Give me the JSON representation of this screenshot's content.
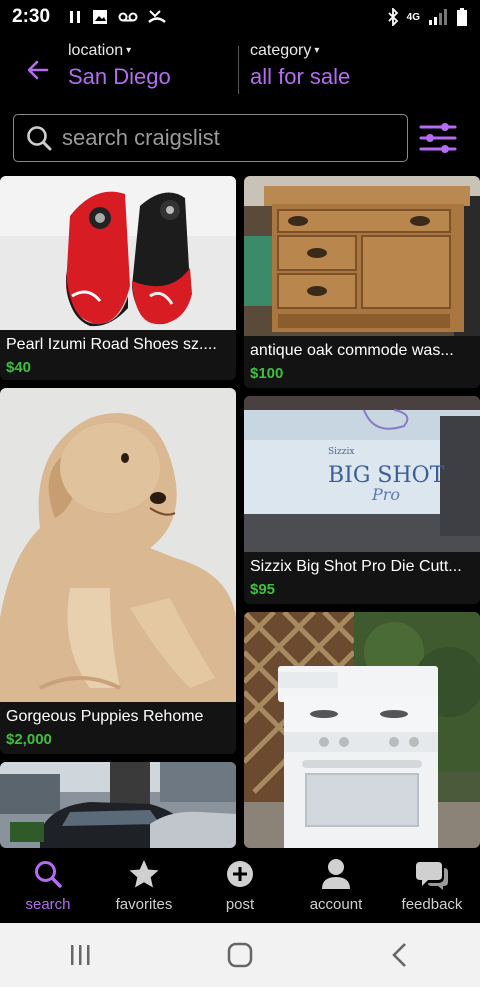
{
  "status_bar": {
    "time": "2:30",
    "network": "4G"
  },
  "header": {
    "location_label": "location",
    "location_value": "San Diego",
    "category_label": "category",
    "category_value": "all for sale",
    "caret": "▾"
  },
  "search": {
    "placeholder": "search craigslist"
  },
  "listings": [
    {
      "title": "Pearl Izumi Road Shoes sz....",
      "price": "$40"
    },
    {
      "title": "antique oak commode was...",
      "price": "$100"
    },
    {
      "title": "Gorgeous Puppies Rehome",
      "price": "$2,000"
    },
    {
      "title": "Sizzix Big Shot Pro Die Cutt...",
      "price": "$95"
    },
    {
      "title": "",
      "price": ""
    },
    {
      "title": "",
      "price": ""
    }
  ],
  "photo_text": {
    "sizzix_brand": "Sizzix",
    "sizzix_product": "BIG SHOT",
    "sizzix_model": "Pro"
  },
  "bottom_nav": [
    {
      "label": "search",
      "icon": "search-icon",
      "active": true
    },
    {
      "label": "favorites",
      "icon": "star-icon",
      "active": false
    },
    {
      "label": "post",
      "icon": "plus-circle-icon",
      "active": false
    },
    {
      "label": "account",
      "icon": "person-icon",
      "active": false
    },
    {
      "label": "feedback",
      "icon": "chat-bubbles-icon",
      "active": false
    }
  ],
  "colors": {
    "accent": "#b46cf0",
    "price": "#3fbf3f",
    "background": "#000000"
  }
}
